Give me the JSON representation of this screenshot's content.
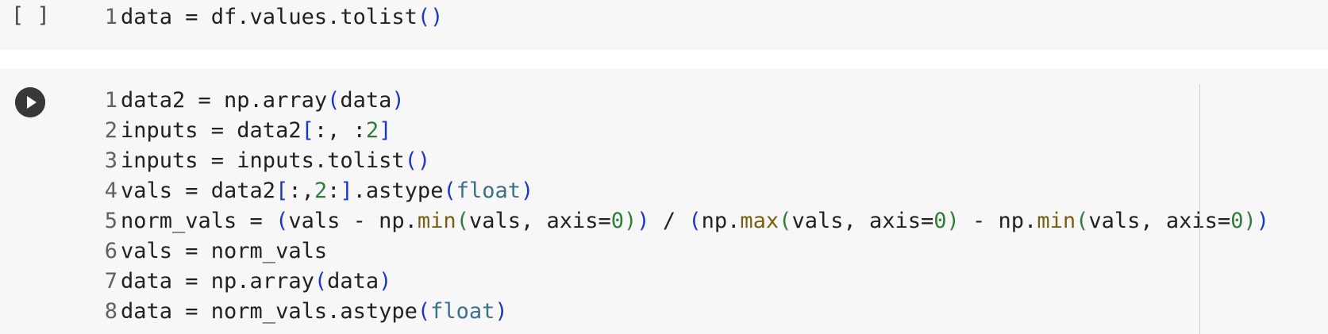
{
  "cells": [
    {
      "prompt": "[ ]",
      "lines": [
        {
          "number": "1",
          "tokens": [
            {
              "t": "data = df.values.tolist",
              "k": "plain"
            },
            {
              "t": "()",
              "k": "bracket"
            }
          ]
        }
      ]
    },
    {
      "run_icon": "play-circle-icon",
      "lines": [
        {
          "number": "1",
          "tokens": [
            {
              "t": "data2 = np.array",
              "k": "plain"
            },
            {
              "t": "(",
              "k": "bracket"
            },
            {
              "t": "data",
              "k": "plain"
            },
            {
              "t": ")",
              "k": "bracket"
            }
          ]
        },
        {
          "number": "2",
          "tokens": [
            {
              "t": "inputs = data2",
              "k": "plain"
            },
            {
              "t": "[",
              "k": "bracket"
            },
            {
              "t": ":, :",
              "k": "plain"
            },
            {
              "t": "2",
              "k": "num"
            },
            {
              "t": "]",
              "k": "bracket"
            }
          ]
        },
        {
          "number": "3",
          "tokens": [
            {
              "t": "inputs = inputs.tolist",
              "k": "plain"
            },
            {
              "t": "()",
              "k": "bracket"
            }
          ]
        },
        {
          "number": "4",
          "tokens": [
            {
              "t": "vals = data2",
              "k": "plain"
            },
            {
              "t": "[",
              "k": "bracket"
            },
            {
              "t": ":,",
              "k": "plain"
            },
            {
              "t": "2",
              "k": "num"
            },
            {
              "t": ":",
              "k": "plain"
            },
            {
              "t": "]",
              "k": "bracket"
            },
            {
              "t": ".astype",
              "k": "plain"
            },
            {
              "t": "(",
              "k": "bracket"
            },
            {
              "t": "float",
              "k": "type"
            },
            {
              "t": ")",
              "k": "bracket"
            }
          ]
        },
        {
          "number": "5",
          "tokens": [
            {
              "t": "norm_vals = ",
              "k": "plain"
            },
            {
              "t": "(",
              "k": "bracket"
            },
            {
              "t": "vals - np.",
              "k": "plain"
            },
            {
              "t": "min",
              "k": "builtin"
            },
            {
              "t": "(",
              "k": "num"
            },
            {
              "t": "vals, axis=",
              "k": "plain"
            },
            {
              "t": "0",
              "k": "num"
            },
            {
              "t": ")",
              "k": "num"
            },
            {
              "t": ")",
              "k": "bracket"
            },
            {
              "t": " / ",
              "k": "plain"
            },
            {
              "t": "(",
              "k": "bracket"
            },
            {
              "t": "np.",
              "k": "plain"
            },
            {
              "t": "max",
              "k": "builtin"
            },
            {
              "t": "(",
              "k": "num"
            },
            {
              "t": "vals, axis=",
              "k": "plain"
            },
            {
              "t": "0",
              "k": "num"
            },
            {
              "t": ")",
              "k": "num"
            },
            {
              "t": " - np.",
              "k": "plain"
            },
            {
              "t": "min",
              "k": "builtin"
            },
            {
              "t": "(",
              "k": "num"
            },
            {
              "t": "vals, axis=",
              "k": "plain"
            },
            {
              "t": "0",
              "k": "num"
            },
            {
              "t": ")",
              "k": "num"
            },
            {
              "t": ")",
              "k": "bracket"
            }
          ]
        },
        {
          "number": "6",
          "tokens": [
            {
              "t": "vals = norm_vals",
              "k": "plain"
            }
          ]
        },
        {
          "number": "7",
          "tokens": [
            {
              "t": "data = np.array",
              "k": "plain"
            },
            {
              "t": "(",
              "k": "bracket"
            },
            {
              "t": "data",
              "k": "plain"
            },
            {
              "t": ")",
              "k": "bracket"
            }
          ]
        },
        {
          "number": "8",
          "tokens": [
            {
              "t": "data = norm_vals.astype",
              "k": "plain"
            },
            {
              "t": "(",
              "k": "bracket"
            },
            {
              "t": "float",
              "k": "type"
            },
            {
              "t": ")",
              "k": "bracket"
            }
          ]
        }
      ]
    }
  ],
  "colors": {
    "cell_bg": "#f7f7f7",
    "text": "#212121",
    "line_number": "#616161",
    "bracket": "#1a37c7",
    "number": "#2e7d3a",
    "builtin": "#7a5f12",
    "type": "#3b6f8a",
    "run_button": "#383838"
  }
}
